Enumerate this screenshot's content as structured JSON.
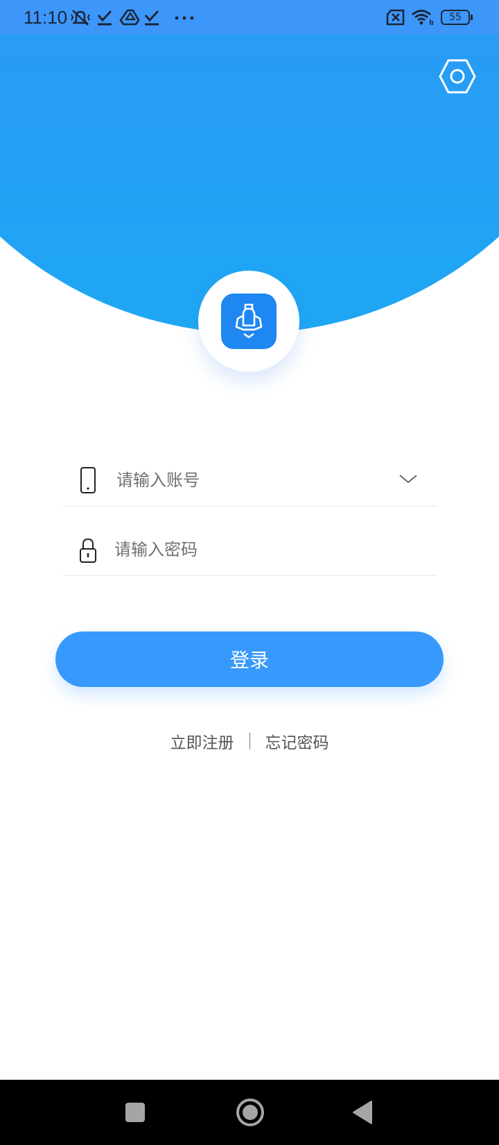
{
  "status_bar": {
    "time": "11:10",
    "battery": "55"
  },
  "login_form": {
    "account_placeholder": "请输入账号",
    "password_placeholder": "请输入密码",
    "login_label": "登录"
  },
  "links": {
    "register_label": "立即注册",
    "forgot_label": "忘记密码"
  },
  "icons": {
    "settings": "hexagon-settings-icon",
    "logo": "app-logo-icon",
    "account": "phone-icon",
    "password": "lock-icon",
    "dropdown": "chevron-down-icon"
  },
  "colors": {
    "primary": "#3799fb",
    "header_top": "#4589fb",
    "header_bottom": "#1ea7f3",
    "logo_bg": "#1f87f1",
    "nav_bar": "#000000"
  }
}
